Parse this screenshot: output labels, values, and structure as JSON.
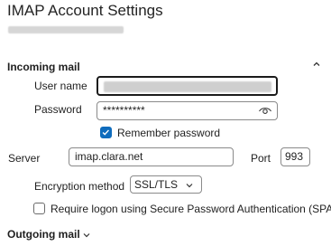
{
  "header": {
    "title": "IMAP Account Settings"
  },
  "incoming": {
    "section_label": "Incoming mail",
    "username_label": "User name",
    "username_value": "",
    "password_label": "Password",
    "password_value": "**********",
    "remember_label": "Remember password",
    "remember_checked": true,
    "server_label": "Server",
    "server_value": "imap.clara.net",
    "port_label": "Port",
    "port_value": "993",
    "encryption_label": "Encryption method",
    "encryption_value": "SSL/TLS",
    "spa_label": "Require logon using Secure Password Authentication (SPA)",
    "spa_checked": false
  },
  "outgoing": {
    "section_label": "Outgoing mail"
  },
  "icons": {
    "collapse": "chevron-up-icon",
    "expand": "chevron-down-icon",
    "reveal": "eye-icon",
    "dropdown": "chevron-down-icon"
  },
  "colors": {
    "accent": "#0f6cbd",
    "border": "#8a8a8a",
    "text": "#1f1f1f"
  }
}
